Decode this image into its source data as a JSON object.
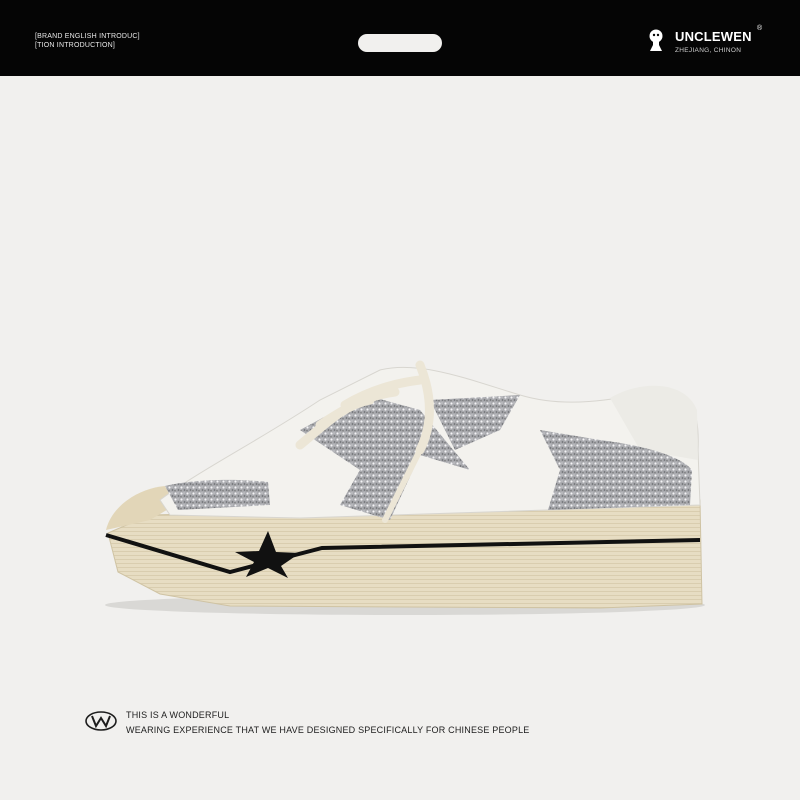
{
  "header": {
    "left_line1": "[BRAND ENGLISH INTRODUC]",
    "left_line2": "[TION INTRODUCTION]",
    "brand_name": "UNCLEWEN",
    "registered_mark": "®",
    "brand_location": "ZHEJIANG, CHINON"
  },
  "footer": {
    "line1": "THIS IS A WONDERFUL",
    "line2": "WEARING EXPERIENCE THAT WE HAVE DESIGNED SPECIFICALLY FOR CHINESE PEOPLE"
  },
  "colors": {
    "header_bg": "#050505",
    "page_bg": "#f1f0ee",
    "sole": "#e6dcc0",
    "glitter": "#b7b8bc",
    "star": "#111111"
  }
}
